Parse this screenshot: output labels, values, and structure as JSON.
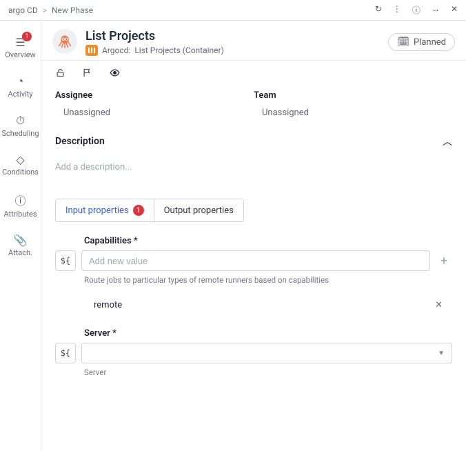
{
  "breadcrumbs": {
    "root": "argo CD",
    "current": "New Phase"
  },
  "topIcons": {
    "refresh": "refresh-icon",
    "more": "more-vertical-icon",
    "info": "info-icon",
    "expand": "expand-horizontal-icon",
    "close": "close-icon"
  },
  "sidenav": {
    "items": [
      {
        "key": "overview",
        "label": "Overview",
        "icon": "list-icon",
        "badge": "1"
      },
      {
        "key": "activity",
        "label": "Activity",
        "icon": "clock-icon"
      },
      {
        "key": "scheduling",
        "label": "Scheduling",
        "icon": "stopwatch-icon"
      },
      {
        "key": "conditions",
        "label": "Conditions",
        "icon": "diamond-icon"
      },
      {
        "key": "attributes",
        "label": "Attributes",
        "icon": "info-circle-icon"
      },
      {
        "key": "attach",
        "label": "Attach.",
        "icon": "paperclip-icon"
      }
    ]
  },
  "header": {
    "title": "List Projects",
    "subtitle_prefix": "Argocd:",
    "subtitle_name": "List Projects (Container)",
    "status": "Planned"
  },
  "actionIcons": {
    "lock": "lock-icon",
    "flag": "flag-icon",
    "watch": "eye-icon"
  },
  "fields": {
    "assignee": {
      "label": "Assignee",
      "value": "Unassigned"
    },
    "team": {
      "label": "Team",
      "value": "Unassigned"
    }
  },
  "description": {
    "label": "Description",
    "placeholder": "Add a description..."
  },
  "tabs": {
    "input": {
      "label": "Input properties",
      "badge": "1",
      "selected": true
    },
    "output": {
      "label": "Output properties",
      "selected": false
    }
  },
  "form": {
    "capabilities": {
      "label": "Capabilities *",
      "placeholder": "Add new value",
      "help": "Route jobs to particular types of remote runners based on capabilities",
      "values": [
        "remote"
      ]
    },
    "server": {
      "label": "Server *",
      "value": "",
      "help": "Server"
    },
    "varButton": "${"
  }
}
